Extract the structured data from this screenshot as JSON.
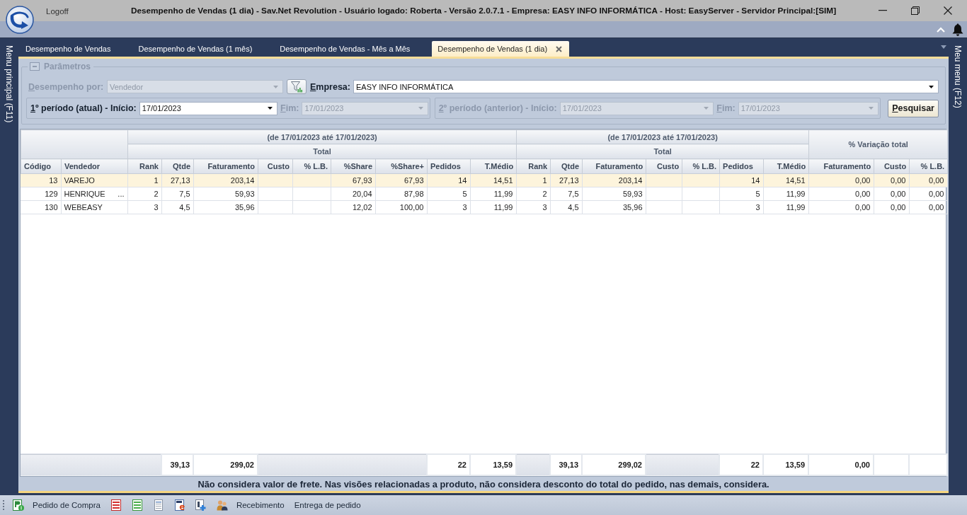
{
  "window": {
    "logoff": "Logoff",
    "title": "Desempenho de Vendas (1 dia) - Sav.Net Revolution - Usuário logado: Roberta - Versão 2.0.7.1 - Empresa: EASY INFO INFORMÁTICA - Host: EasyServer - Servidor Principal:[SIM]"
  },
  "side_menus": {
    "left": "Menu principal (F11)",
    "right": "Meu menu (F12)"
  },
  "tabs": [
    {
      "label": "Desempenho de Vendas",
      "selected": false
    },
    {
      "label": "Desempenho de Vendas (1 mês)",
      "selected": false
    },
    {
      "label": "Desempenho de Vendas - Mês a Mês",
      "selected": false
    },
    {
      "label": "Desempenho de Vendas (1 dia)",
      "selected": true
    }
  ],
  "parameters": {
    "title": "Parâmetros",
    "expanded": true,
    "performance_by": {
      "label": "Desempenho por:",
      "value": "Vendedor",
      "disabled": true
    },
    "company": {
      "label": "Empresa:",
      "value": "EASY INFO INFORMÁTICA",
      "disabled": false
    },
    "periods": [
      {
        "start_label": "1º período (atual) - Início:",
        "start": "17/01/2023",
        "start_disabled": false,
        "end_label": "Fim:",
        "end": "17/01/2023",
        "end_disabled": true
      },
      {
        "start_label": "2º período (anterior) - Início:",
        "start": "17/01/2023",
        "start_disabled": true,
        "end_label": "Fim:",
        "end": "17/01/2023",
        "end_disabled": true
      }
    ],
    "search_button": "Pesquisar"
  },
  "table": {
    "column_groups": [
      {
        "columns": [
          {
            "label": "Código",
            "kind": "key"
          },
          {
            "label": "Vendedor",
            "kind": "text"
          }
        ]
      },
      {
        "title": "(de 17/01/2023 até 17/01/2023)",
        "subtitle": "Total",
        "columns": [
          {
            "label": "Rank",
            "kind": "number"
          },
          {
            "label": "Qtde",
            "kind": "number"
          },
          {
            "label": "Faturamento",
            "kind": "number"
          },
          {
            "label": "Custo",
            "kind": "number"
          },
          {
            "label": "% L.B.",
            "kind": "number"
          },
          {
            "label": "%Share",
            "kind": "number"
          },
          {
            "label": "%Share+",
            "kind": "number"
          },
          {
            "label": "Pedidos",
            "kind": "count"
          },
          {
            "label": "T.Médio",
            "kind": "number"
          }
        ]
      },
      {
        "title": "(de 17/01/2023 até 17/01/2023)",
        "subtitle": "Total",
        "columns": [
          {
            "label": "Rank",
            "kind": "number"
          },
          {
            "label": "Qtde",
            "kind": "number"
          },
          {
            "label": "Faturamento",
            "kind": "number"
          },
          {
            "label": "Custo",
            "kind": "number"
          },
          {
            "label": "% L.B.",
            "kind": "number"
          },
          {
            "label": "Pedidos",
            "kind": "count"
          },
          {
            "label": "T.Médio",
            "kind": "number"
          }
        ]
      },
      {
        "title": "% Variação total",
        "columns": [
          {
            "label": "Faturamento",
            "kind": "number"
          },
          {
            "label": "Custo",
            "kind": "number"
          },
          {
            "label": "% L.B.",
            "kind": "number"
          }
        ]
      }
    ],
    "rows": [
      {
        "selected": true,
        "cells": [
          "13",
          "VAREJO",
          "1",
          "27,13",
          "203,14",
          null,
          null,
          "67,93",
          "67,93",
          "14",
          "14,51",
          "1",
          "27,13",
          "203,14",
          null,
          null,
          "14",
          "14,51",
          "0,00",
          "0,00",
          "0,00"
        ]
      },
      {
        "selected": false,
        "cells": [
          "129",
          {
            "text": "HENRIQUE",
            "overflow": "..."
          },
          "2",
          "7,5",
          "59,93",
          null,
          null,
          "20,04",
          "87,98",
          "5",
          "11,99",
          "2",
          "7,5",
          "59,93",
          null,
          null,
          "5",
          "11,99",
          "0,00",
          "0,00",
          "0,00"
        ]
      },
      {
        "selected": false,
        "cells": [
          "130",
          "WEBEASY",
          "3",
          "4,5",
          "35,96",
          null,
          null,
          "12,02",
          "100,00",
          "3",
          "11,99",
          "3",
          "4,5",
          "35,96",
          null,
          null,
          "3",
          "11,99",
          "0,00",
          "0,00",
          "0,00"
        ]
      }
    ],
    "totals": [
      {
        "kind": "blank"
      },
      {
        "kind": "blank"
      },
      {
        "kind": "blank"
      },
      {
        "kind": "sum",
        "value": "39,13"
      },
      {
        "kind": "sum",
        "value": "299,02"
      },
      {
        "kind": "blank"
      },
      {
        "kind": "blank"
      },
      {
        "kind": "blank"
      },
      {
        "kind": "blank"
      },
      {
        "kind": "sum",
        "value": "22"
      },
      {
        "kind": "sum",
        "value": "13,59"
      },
      {
        "kind": "blank"
      },
      {
        "kind": "sum",
        "value": "39,13"
      },
      {
        "kind": "sum",
        "value": "299,02"
      },
      {
        "kind": "blank"
      },
      {
        "kind": "blank"
      },
      {
        "kind": "sum",
        "value": "22"
      },
      {
        "kind": "sum",
        "value": "13,59"
      },
      {
        "kind": "sum",
        "value": "0,00"
      },
      {
        "kind": "sum"
      },
      {
        "kind": "sum"
      }
    ]
  },
  "note": "Não considera valor de frete. Nas visões relacionadas a produto, não considera desconto do total do pedido, nas demais, considera.",
  "toolbar": [
    {
      "label": "Pedido de Compra",
      "icon": true
    },
    {
      "icon": true
    },
    {
      "icon": true
    },
    {
      "icon": true
    },
    {
      "icon": true
    },
    {
      "icon": true
    },
    {
      "label": "Recebimento",
      "icon": true
    },
    {
      "label": "Entrega de pedido",
      "icon": false
    }
  ]
}
